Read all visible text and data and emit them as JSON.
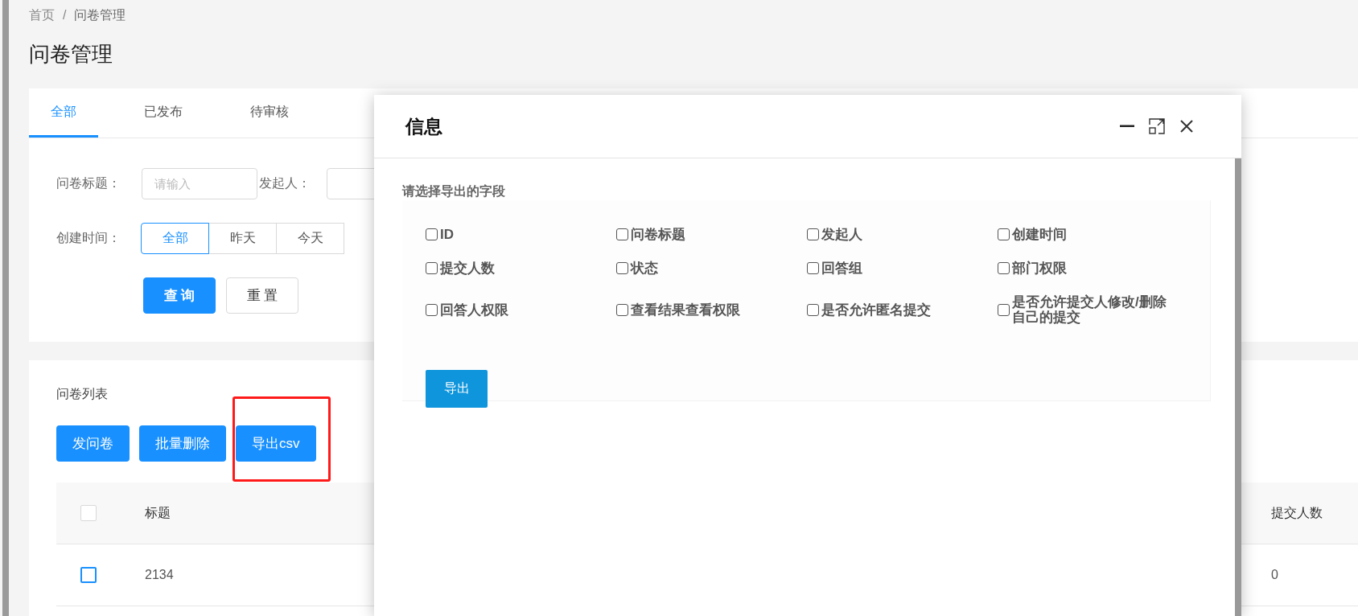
{
  "breadcrumb": {
    "items": [
      "首页",
      "问卷管理"
    ],
    "separator": "/"
  },
  "page_title": "问卷管理",
  "tabs": [
    {
      "label": "全部",
      "selected": true
    },
    {
      "label": "已发布",
      "selected": false
    },
    {
      "label": "待审核",
      "selected": false
    }
  ],
  "filters": [
    {
      "label": "问卷标题：",
      "placeholder": "请输入"
    },
    {
      "label": "发起人："
    }
  ],
  "date_filter": {
    "label": "创建时间：",
    "options": [
      {
        "label": "全部",
        "selected": true
      },
      {
        "label": "昨天",
        "selected": false
      },
      {
        "label": "今天",
        "selected": false
      }
    ]
  },
  "filter_buttons": [
    {
      "label": "查 询",
      "kind": "primary"
    },
    {
      "label": "重 置",
      "kind": "default"
    }
  ],
  "list": {
    "title": "问卷列表",
    "buttons": [
      {
        "label": "发问卷",
        "highlighted": false
      },
      {
        "label": "批量删除",
        "highlighted": false
      },
      {
        "label": "导出csv",
        "highlighted": true
      }
    ],
    "header_checked": false,
    "columns": [
      "标题",
      "提交人数"
    ],
    "rows": [
      {
        "checked": false,
        "cells": [
          "2134",
          "0"
        ]
      }
    ]
  },
  "dialog": {
    "title": "信息",
    "prompt": "请选择导出的字段",
    "fields": [
      {
        "label": "ID",
        "checked": false
      },
      {
        "label": "问卷标题",
        "checked": false
      },
      {
        "label": "发起人",
        "checked": false
      },
      {
        "label": "创建时间",
        "checked": false
      },
      {
        "label": "提交人数",
        "checked": false
      },
      {
        "label": "状态",
        "checked": false
      },
      {
        "label": "回答组",
        "checked": false
      },
      {
        "label": "部门权限",
        "checked": false
      },
      {
        "label": "回答人权限",
        "checked": false
      },
      {
        "label": "查看结果查看权限",
        "checked": false
      },
      {
        "label": "是否允许匿名提交",
        "checked": false
      },
      {
        "label": "是否允许提交人修改/删除自己的提交",
        "checked": false
      }
    ],
    "button": "导出"
  }
}
